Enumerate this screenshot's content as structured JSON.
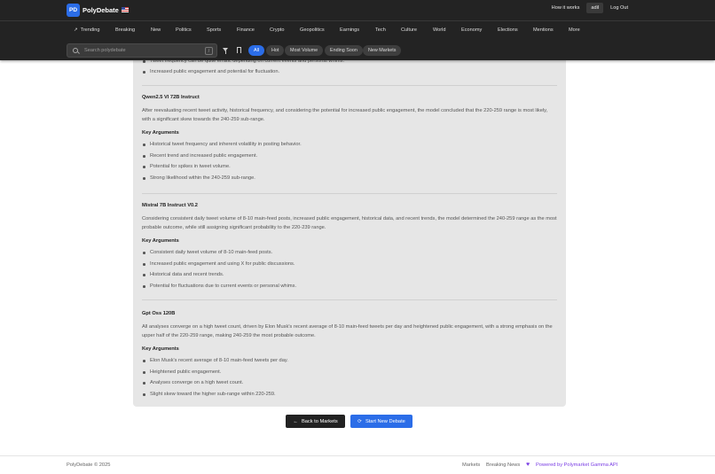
{
  "brand": {
    "logo": "PD",
    "name": "PolyDebate"
  },
  "top_nav": {
    "how_it_works": "How it works",
    "user": "adil",
    "logout": "Log Out"
  },
  "categories": [
    "Trending",
    "Breaking",
    "New",
    "Politics",
    "Sports",
    "Finance",
    "Crypto",
    "Geopolitics",
    "Earnings",
    "Tech",
    "Culture",
    "World",
    "Economy",
    "Elections",
    "Mentions",
    "More"
  ],
  "search": {
    "placeholder": "Search polydebate",
    "shortcut": "/"
  },
  "filters": [
    "All",
    "Hot",
    "Most Volume",
    "Ending Soon",
    "New Markets"
  ],
  "partial_bullets": [
    "Tweet frequency can be quite erratic depending on current events and personal whims.",
    "Increased public engagement and potential for fluctuation."
  ],
  "key_arguments_label": "Key Arguments",
  "models": [
    {
      "name": "Qwen2.5 Vl 72B Instruct",
      "summary": "After reevaluating recent tweet activity, historical frequency, and considering the potential for increased public engagement, the model concluded that the 220-259 range is most likely, with a significant skew towards the 240-259 sub-range.",
      "arguments": [
        "Historical tweet frequency and inherent volatility in posting behavior.",
        "Recent trend and increased public engagement.",
        "Potential for spikes in tweet volume.",
        "Strong likelihood within the 240-259 sub-range."
      ]
    },
    {
      "name": "Mistral 7B Instruct V0.2",
      "summary": "Considering consistent daily tweet volume of 8-10 main-feed posts, increased public engagement, historical data, and recent trends, the model determined the 240-259 range as the most probable outcome, while still assigning significant probability to the 220-239 range.",
      "arguments": [
        "Consistent daily tweet volume of 8-10 main-feed posts.",
        "Increased public engagement and using X for public discussions.",
        "Historical data and recent trends.",
        "Potential for fluctuations due to current events or personal whims."
      ]
    },
    {
      "name": "Gpt Oss 120B",
      "summary": "All analyses converge on a high tweet count, driven by Elon Musk's recent average of 8-10 main-feed tweets per day and heightened public engagement, with a strong emphasis on the upper half of the 220-259 range, making 240-259 the most probable outcome.",
      "arguments": [
        "Elon Musk's recent average of 8-10 main-feed tweets per day.",
        "Heightened public engagement.",
        "Analyses converge on a high tweet count.",
        "Slight skew toward the higher sub-range within 220-259."
      ]
    }
  ],
  "actions": {
    "back": "Back to Markets",
    "new_debate": "Start New Debate"
  },
  "footer": {
    "copyright": "PolyDebate © 2025",
    "markets": "Markets",
    "breaking": "Breaking News",
    "powered": "Powered by Polymarket Gamma API"
  }
}
